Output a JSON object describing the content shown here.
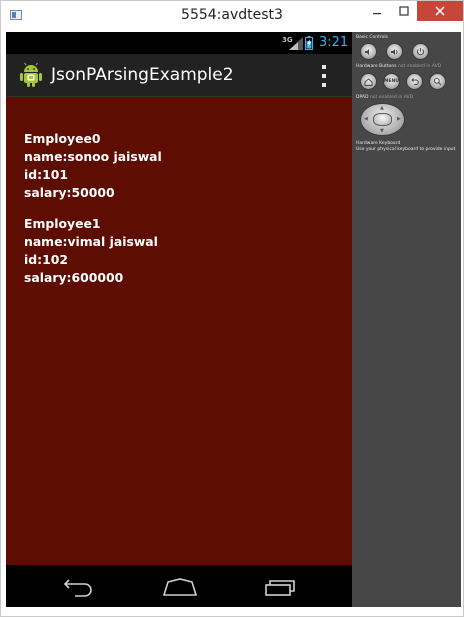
{
  "window": {
    "title": "5554:avdtest3",
    "minimize_icon": "minimize-icon",
    "maximize_icon": "maximize-icon",
    "close_icon": "close-icon",
    "close_color": "#c7463a"
  },
  "status_bar": {
    "network": "3G",
    "clock": "3:21",
    "clock_color": "#33b5e5"
  },
  "action_bar": {
    "title": "JsonPArsingExample2",
    "app_icon": "android-icon",
    "menu_icon": "overflow-menu-icon"
  },
  "content": {
    "background": "#5e0d03",
    "employees": [
      {
        "heading": "Employee0",
        "name": "name:sonoo jaiswal",
        "id": "id:101",
        "salary": "salary:50000"
      },
      {
        "heading": "Employee1",
        "name": "name:vimal jaiswal",
        "id": "id:102",
        "salary": "salary:600000"
      }
    ]
  },
  "nav_bar": {
    "back_icon": "back-icon",
    "home_icon": "home-icon",
    "recent_icon": "recent-apps-icon"
  },
  "controls": {
    "basic_controls_label": "Basic Controls",
    "hardware_buttons_label": "Hardware Buttons",
    "hardware_buttons_note": "not enabled in AVD",
    "dpad_label": "DPAD",
    "dpad_note": "not enabled in AVD",
    "keyboard_label": "Hardware Keyboard",
    "keyboard_note": "Use your physical keyboard to provide input",
    "menu_button": "MENU"
  }
}
